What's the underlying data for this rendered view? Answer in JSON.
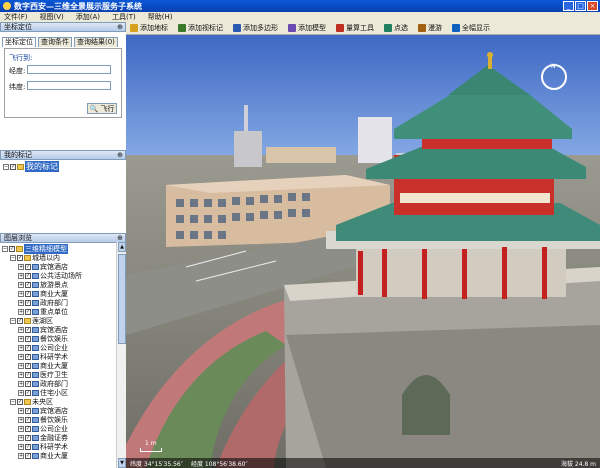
{
  "window": {
    "title": "数字西安—三维全景展示服务子系统"
  },
  "menu": [
    "文件(F)",
    "视图(V)",
    "添加(A)",
    "工具(T)",
    "帮助(H)"
  ],
  "toolbar": [
    {
      "label": "添加地标",
      "icon": "placemark-icon",
      "color": "#d8a020"
    },
    {
      "label": "添加视标记",
      "icon": "view-marker-icon",
      "color": "#3a7a2a"
    },
    {
      "label": "添加多边形",
      "icon": "polygon-icon",
      "color": "#2a5ab0"
    },
    {
      "label": "添加模型",
      "icon": "model-icon",
      "color": "#6a4ab0"
    },
    {
      "label": "量算工具",
      "icon": "ruler-icon",
      "color": "#c03020"
    },
    {
      "label": "点选",
      "icon": "pointer-icon",
      "color": "#208060"
    },
    {
      "label": "漫游",
      "icon": "roam-icon",
      "color": "#a06010"
    },
    {
      "label": "全幅显示",
      "icon": "globe-icon",
      "color": "#1060c0"
    }
  ],
  "panels": {
    "locate": {
      "title": "坐标定位"
    },
    "marks": {
      "title": "我的标记"
    },
    "layers": {
      "title": "图层浏览"
    }
  },
  "tabs": [
    "坐标定位",
    "查询条件",
    "查询结果(0)"
  ],
  "fly": {
    "legend": "飞行到:",
    "lon_label": "经度:",
    "lat_label": "纬度:",
    "lon_value": "",
    "lat_value": "",
    "button": "飞行"
  },
  "marks_tree": {
    "root": "我的标记"
  },
  "layers_tree": [
    {
      "level": 0,
      "label": "三维精细模型",
      "selected": true,
      "type": "folder"
    },
    {
      "level": 1,
      "label": "城墙以内",
      "type": "folder"
    },
    {
      "level": 2,
      "label": "宾馆酒店",
      "type": "layer"
    },
    {
      "level": 2,
      "label": "公共活动场所",
      "type": "layer"
    },
    {
      "level": 2,
      "label": "旅游景点",
      "type": "layer"
    },
    {
      "level": 2,
      "label": "商业大厦",
      "type": "layer"
    },
    {
      "level": 2,
      "label": "政府部门",
      "type": "layer"
    },
    {
      "level": 2,
      "label": "重点单位",
      "type": "layer"
    },
    {
      "level": 1,
      "label": "莲湖区",
      "type": "folder"
    },
    {
      "level": 2,
      "label": "宾馆酒店",
      "type": "layer"
    },
    {
      "level": 2,
      "label": "餐饮娱乐",
      "type": "layer"
    },
    {
      "level": 2,
      "label": "公司企业",
      "type": "layer"
    },
    {
      "level": 2,
      "label": "科研学术",
      "type": "layer"
    },
    {
      "level": 2,
      "label": "商业大厦",
      "type": "layer"
    },
    {
      "level": 2,
      "label": "医疗卫生",
      "type": "layer"
    },
    {
      "level": 2,
      "label": "政府部门",
      "type": "layer"
    },
    {
      "level": 2,
      "label": "住宅小区",
      "type": "layer"
    },
    {
      "level": 1,
      "label": "未央区",
      "type": "folder"
    },
    {
      "level": 2,
      "label": "宾馆酒店",
      "type": "layer"
    },
    {
      "level": 2,
      "label": "餐饮娱乐",
      "type": "layer"
    },
    {
      "level": 2,
      "label": "公司企业",
      "type": "layer"
    },
    {
      "level": 2,
      "label": "金融证券",
      "type": "layer"
    },
    {
      "level": 2,
      "label": "科研学术",
      "type": "layer"
    },
    {
      "level": 2,
      "label": "商业大厦",
      "type": "layer"
    }
  ],
  "status": {
    "left": "纬度 34°15′35.56″",
    "mid": "经度 108°56′38.60″",
    "right": "海拔 24.8 m",
    "scale": "1 m"
  }
}
